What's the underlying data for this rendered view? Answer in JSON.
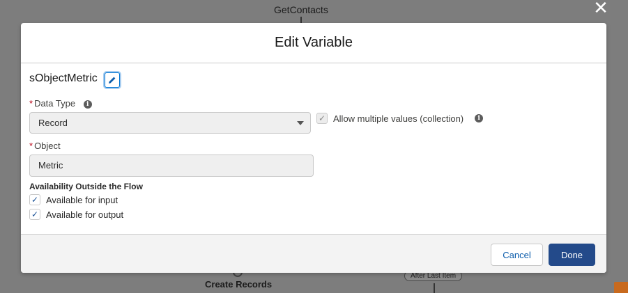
{
  "background": {
    "node_title": "GetContacts",
    "create_records": "Create Records",
    "after_last_item": "After Last Item"
  },
  "modal": {
    "title": "Edit Variable",
    "variable_name": "sObjectMetric",
    "data_type": {
      "label": "Data Type",
      "value": "Record"
    },
    "allow_multiple": {
      "label": "Allow multiple values (collection)",
      "checked": true
    },
    "object": {
      "label": "Object",
      "value": "Metric"
    },
    "availability": {
      "heading": "Availability Outside the Flow",
      "input_label": "Available for input",
      "output_label": "Available for output"
    },
    "footer": {
      "cancel_label": "Cancel",
      "done_label": "Done"
    }
  },
  "colors": {
    "overlay": "#7d7d7d",
    "brand_button": "#234a8a",
    "link": "#0b5cab",
    "required": "#ba0517"
  }
}
